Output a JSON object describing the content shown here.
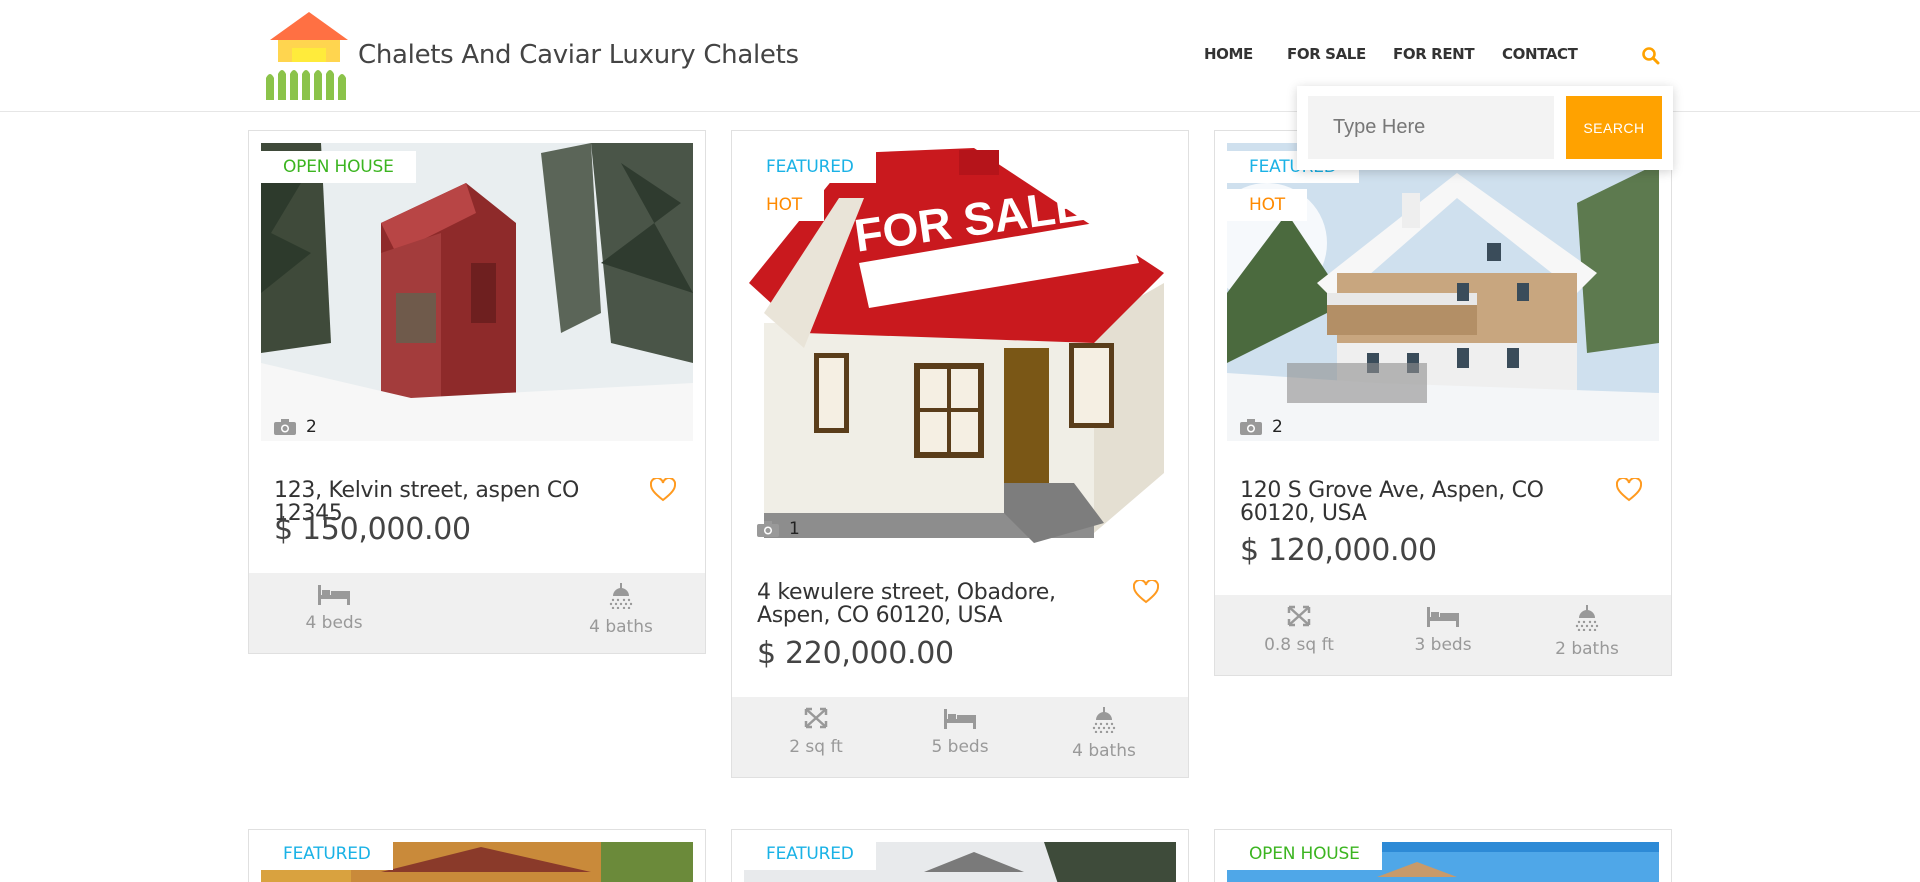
{
  "header": {
    "brand": "Chalets And Caviar Luxury Chalets",
    "nav": [
      "HOME",
      "FOR SALE",
      "FOR RENT",
      "CONTACT"
    ]
  },
  "search": {
    "placeholder": "Type Here",
    "button_label": "SEARCH"
  },
  "colors": {
    "accent": "#ffa200",
    "open_house": "#3cb521",
    "featured": "#1ab2e6",
    "hot": "#ff8a00",
    "feature_bar": "#f0f0f0"
  },
  "listings": [
    {
      "badges": [
        "OPEN HOUSE"
      ],
      "photo_count": "2",
      "address": "123, Kelvin street, aspen CO 12345",
      "price": "$ 150,000.00",
      "features": [
        {
          "icon": "bed-icon",
          "label": "4 beds"
        },
        {
          "icon": "shower-icon",
          "label": "4 baths"
        }
      ]
    },
    {
      "badges": [
        "FEATURED",
        "HOT"
      ],
      "photo_count": "1",
      "address": "4 kewulere street, Obadore, Aspen, CO 60120, USA",
      "price": "$ 220,000.00",
      "features": [
        {
          "icon": "area-icon",
          "label": "2 sq ft"
        },
        {
          "icon": "bed-icon",
          "label": "5 beds"
        },
        {
          "icon": "shower-icon",
          "label": "4 baths"
        }
      ]
    },
    {
      "badges": [
        "FEATURED",
        "HOT"
      ],
      "photo_count": "2",
      "address": "120 S Grove Ave, Aspen, CO 60120, USA",
      "price": "$ 120,000.00",
      "features": [
        {
          "icon": "area-icon",
          "label": "0.8 sq ft"
        },
        {
          "icon": "bed-icon",
          "label": "3 beds"
        },
        {
          "icon": "shower-icon",
          "label": "2 baths"
        }
      ]
    },
    {
      "badges": [
        "FEATURED"
      ]
    },
    {
      "badges": [
        "FEATURED"
      ]
    },
    {
      "badges": [
        "OPEN HOUSE"
      ]
    }
  ]
}
